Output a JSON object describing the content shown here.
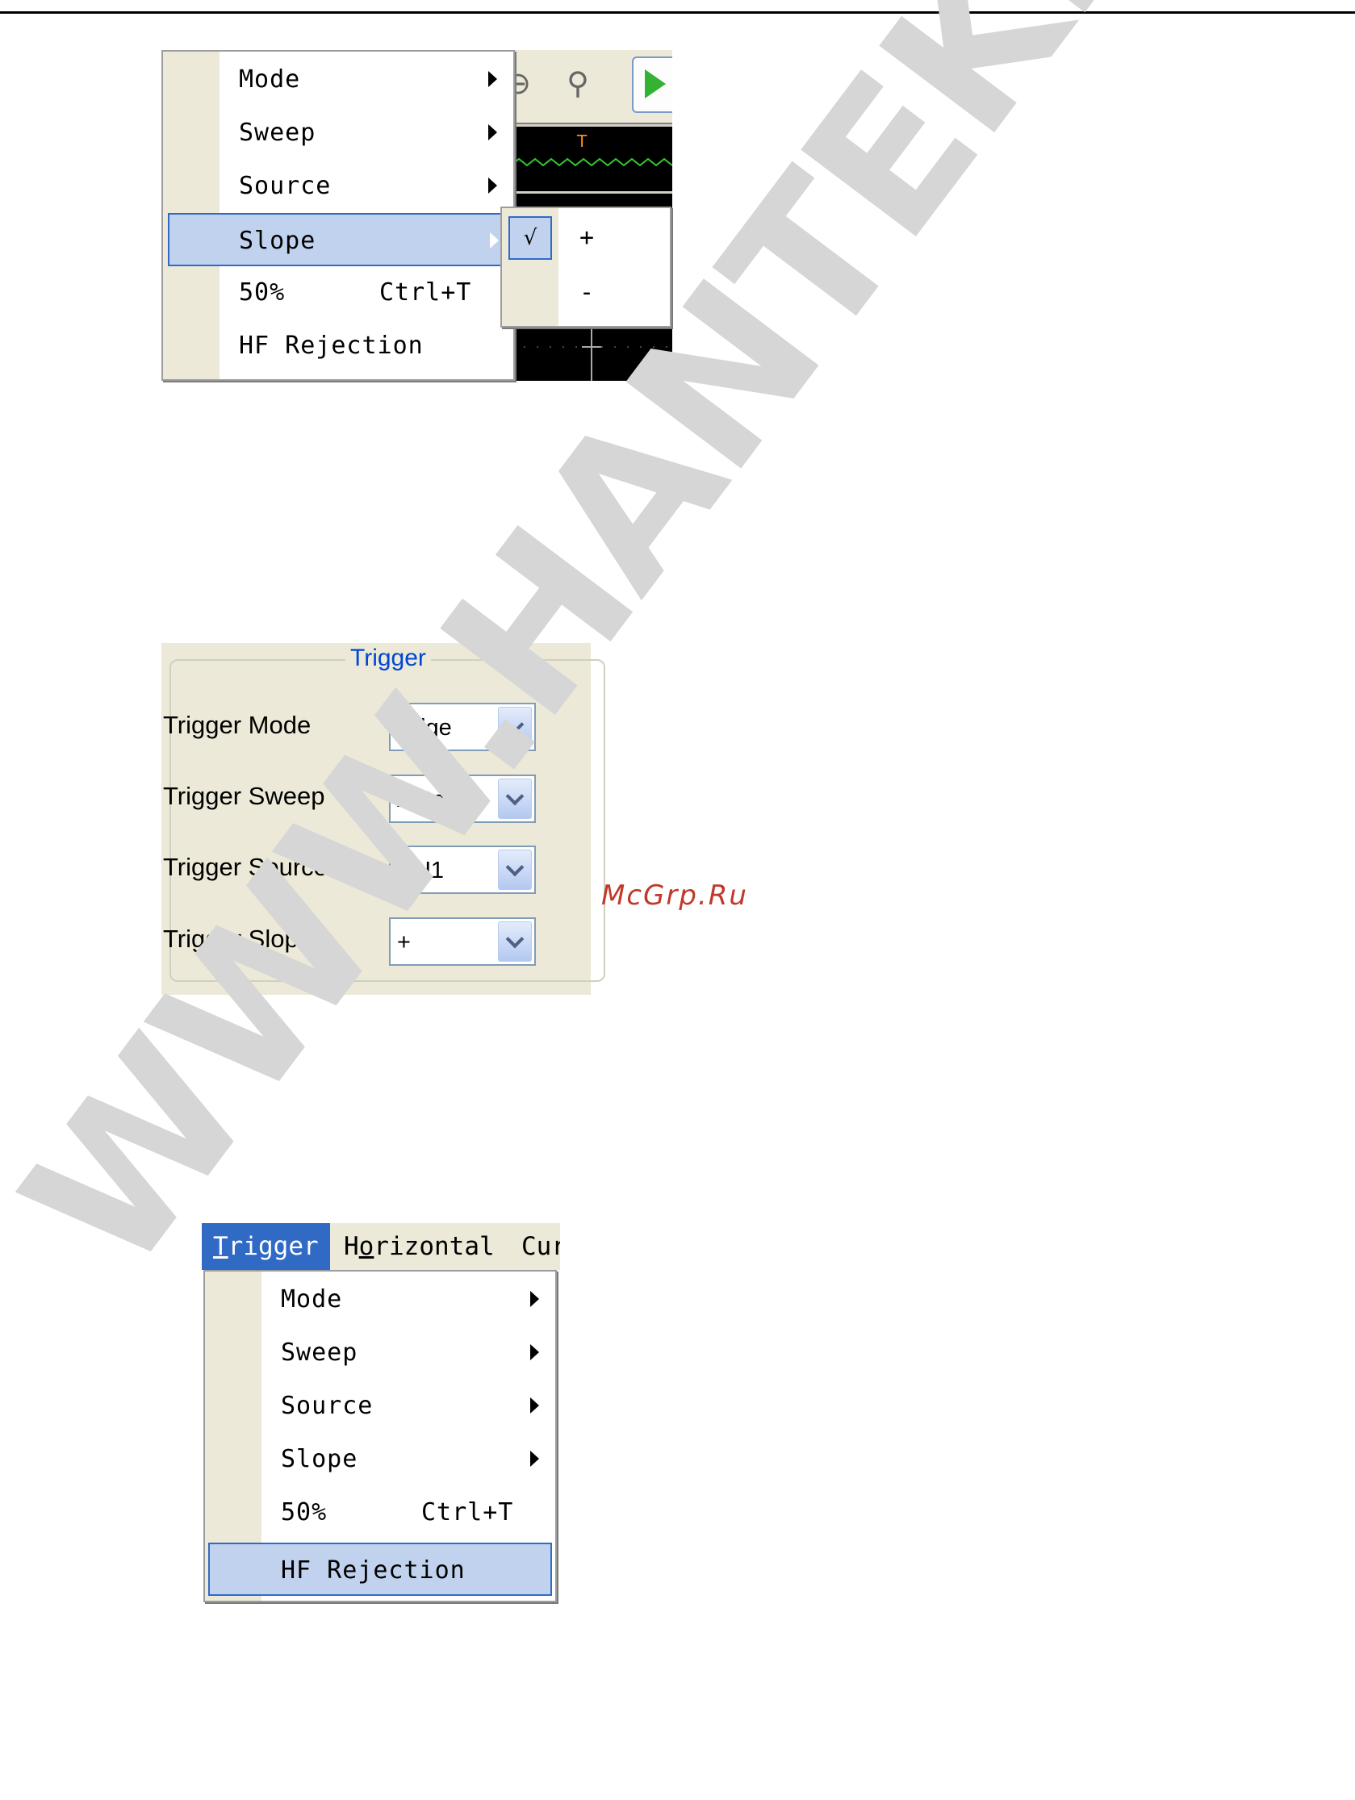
{
  "menu_slope": {
    "items": [
      {
        "label": "Mode",
        "submenu": true
      },
      {
        "label": "Sweep",
        "submenu": true
      },
      {
        "label": "Source",
        "submenu": true
      },
      {
        "label": "Slope",
        "submenu": true,
        "highlighted": true
      },
      {
        "label": "50%",
        "shortcut": "Ctrl+T"
      },
      {
        "label": "HF Rejection"
      }
    ],
    "submenu": {
      "check_mark": "√",
      "items": [
        {
          "label": "+",
          "checked": true
        },
        {
          "label": "-",
          "checked": false
        }
      ]
    },
    "background": {
      "trigger_marker": "T",
      "waveform_color": "#33cc33",
      "marker_color": "#ff8c1a"
    }
  },
  "trigger_panel": {
    "title": "Trigger",
    "title_color": "#0046d5",
    "fields": [
      {
        "label": "Trigger Mode",
        "value": "Edge"
      },
      {
        "label": "Trigger Sweep",
        "value": "Auto"
      },
      {
        "label": "Trigger Source",
        "value": "CH1"
      },
      {
        "label": "Trigger Slope",
        "value": "+"
      }
    ]
  },
  "menu_hf": {
    "menubar": [
      {
        "label": "Trigger",
        "underline": "T",
        "rest": "rigger",
        "active": true
      },
      {
        "label": "Horizontal",
        "pre": "H",
        "underline": "o",
        "rest": "rizontal"
      },
      {
        "label": "Cur"
      }
    ],
    "items": [
      {
        "label": "Mode",
        "submenu": true
      },
      {
        "label": "Sweep",
        "submenu": true
      },
      {
        "label": "Source",
        "submenu": true
      },
      {
        "label": "Slope",
        "submenu": true
      },
      {
        "label": "50%",
        "shortcut": "Ctrl+T"
      },
      {
        "label": "HF Rejection",
        "highlighted": true
      }
    ]
  },
  "watermark": {
    "text": "WWW.HANTEK.RU",
    "site": "McGrp.Ru"
  },
  "colors": {
    "highlight_fill": "#c1d2ee",
    "highlight_border": "#316ac5",
    "menu_gutter": "#ece9d8"
  }
}
